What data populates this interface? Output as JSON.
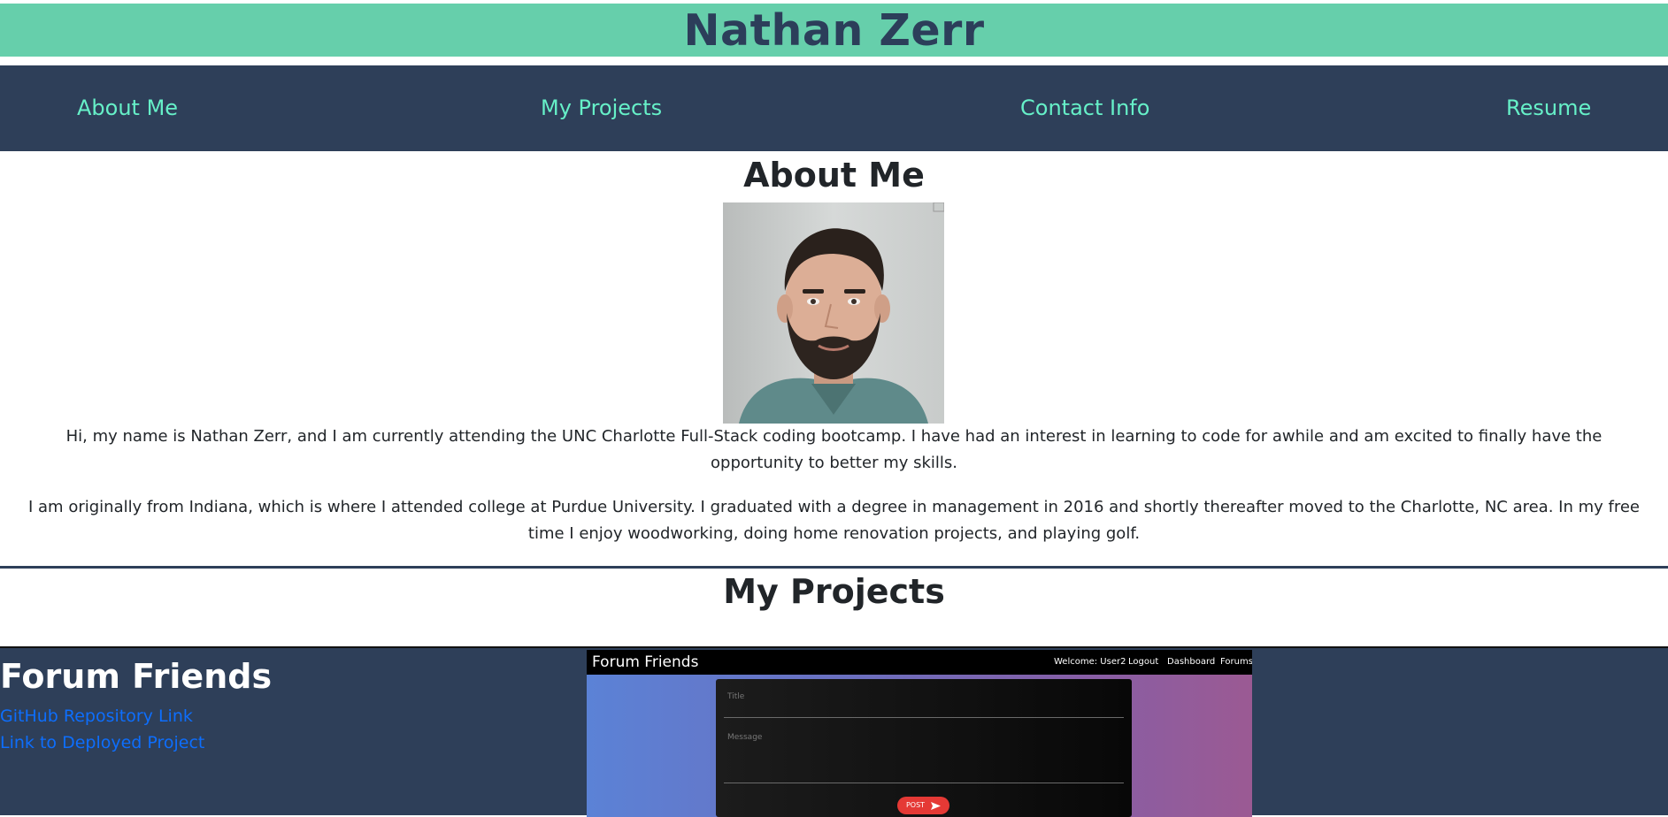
{
  "header": {
    "title": "Nathan Zerr"
  },
  "nav": {
    "items": [
      {
        "label": "About Me"
      },
      {
        "label": "My Projects"
      },
      {
        "label": "Contact Info"
      },
      {
        "label": "Resume"
      }
    ]
  },
  "about": {
    "title": "About Me",
    "paragraphs": [
      "Hi, my name is Nathan Zerr, and I am currently attending the UNC Charlotte Full-Stack coding bootcamp. I have had an interest in learning to code for awhile and am excited to finally have the opportunity to better my skills.",
      "I am originally from Indiana, which is where I attended college at Purdue University. I graduated with a degree in management in 2016 and shortly thereafter moved to the Charlotte, NC area. In my free time I enjoy woodworking, doing home renovation projects, and playing golf."
    ]
  },
  "projects": {
    "title": "My Projects",
    "items": [
      {
        "name": "Forum Friends",
        "github_link": "GitHub Repository Link",
        "deployed_link": "Link to Deployed Project",
        "screenshot": {
          "brand": "Forum Friends",
          "nav": [
            "Welcome: User2",
            "Logout",
            "Dashboard",
            "Forums"
          ],
          "title_placeholder": "Title",
          "message_placeholder": "Message",
          "post_button": "POST"
        }
      }
    ]
  },
  "colors": {
    "header_bg": "#66cfab",
    "nav_bg": "#2e3f59",
    "nav_link": "#66f0c8",
    "link": "#0d6efd"
  }
}
